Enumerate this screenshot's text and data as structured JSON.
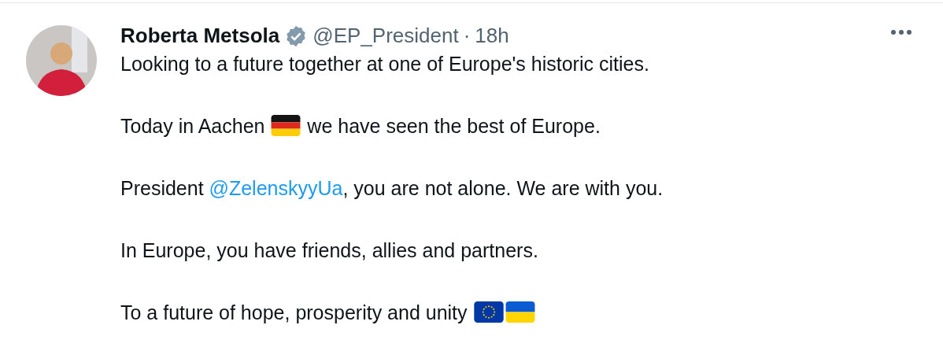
{
  "post": {
    "author_name": "Roberta Metsola",
    "verified": true,
    "handle": "@EP_President",
    "separator": "·",
    "time": "18h",
    "paragraphs": [
      [
        {
          "kind": "text",
          "text": "Looking to a future together at one of Europe's historic cities."
        }
      ],
      [
        {
          "kind": "text",
          "text": "Today in Aachen "
        },
        {
          "kind": "flag_de"
        },
        {
          "kind": "text",
          "text": " we have seen the best of Europe."
        }
      ],
      [
        {
          "kind": "text",
          "text": "President "
        },
        {
          "kind": "link",
          "text": "@ZelenskyyUa"
        },
        {
          "kind": "text",
          "text": ", you are not alone. We are with you."
        }
      ],
      [
        {
          "kind": "text",
          "text": "In Europe, you have friends, allies and partners."
        }
      ],
      [
        {
          "kind": "text",
          "text": "To a future of hope, prosperity and unity "
        },
        {
          "kind": "flag_eu"
        },
        {
          "kind": "flag_ua"
        }
      ]
    ]
  }
}
